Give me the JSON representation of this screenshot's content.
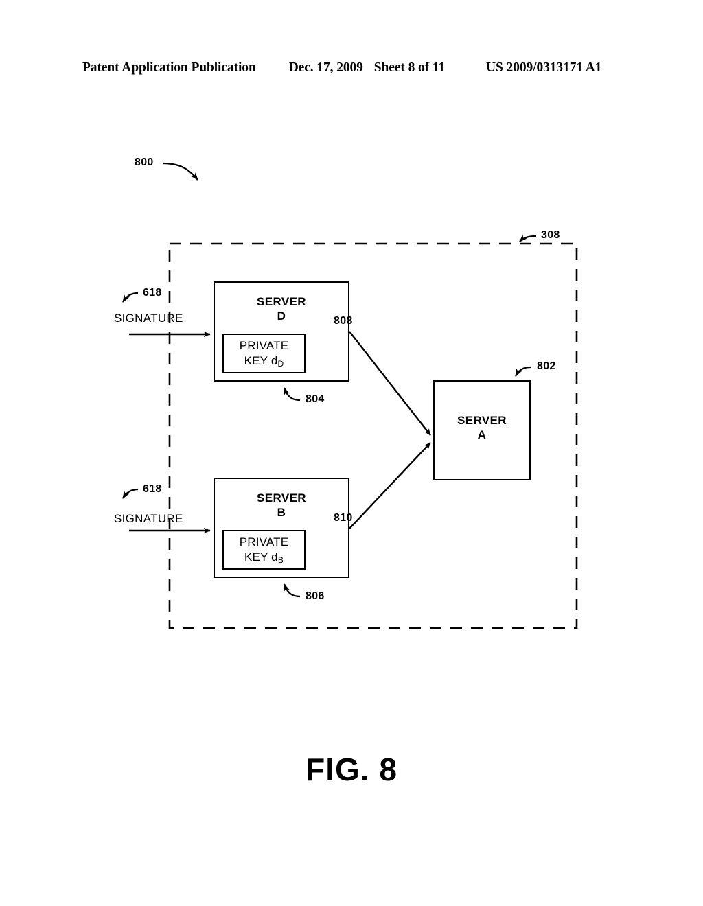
{
  "header": {
    "publication": "Patent Application Publication",
    "date": "Dec. 17, 2009",
    "sheet": "Sheet 8 of 11",
    "patent_number": "US 2009/0313171 A1"
  },
  "figure": {
    "caption": "FIG. 8",
    "diagram_ref": "800",
    "boundary_ref": "308"
  },
  "nodes": {
    "server_d": {
      "title_line1": "SERVER",
      "title_line2": "D",
      "ref": "804",
      "key_ref": "808",
      "key_line1": "PRIVATE",
      "key_line2_text": "KEY d",
      "key_line2_sub": "D"
    },
    "server_b": {
      "title_line1": "SERVER",
      "title_line2": "B",
      "ref": "806",
      "key_ref": "810",
      "key_line1": "PRIVATE",
      "key_line2_text": "KEY d",
      "key_line2_sub": "B"
    },
    "server_a": {
      "title_line1": "SERVER",
      "title_line2": "A",
      "ref": "802"
    }
  },
  "inputs": {
    "signature_top": {
      "label": "SIGNATURE",
      "ref": "618"
    },
    "signature_bottom": {
      "label": "SIGNATURE",
      "ref": "618"
    }
  },
  "colors": {
    "ink": "#000000",
    "paper": "#ffffff"
  }
}
